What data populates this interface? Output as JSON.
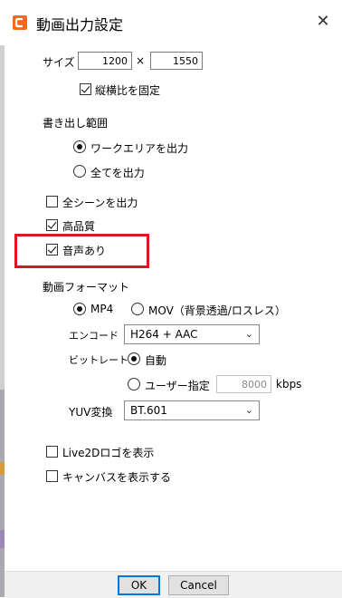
{
  "window": {
    "title": "動画出力設定",
    "close_glyph": "✕"
  },
  "size": {
    "label": "サイズ",
    "width": "1200",
    "separator": "×",
    "height": "1550",
    "keep_ratio_label": "縦横比を固定",
    "keep_ratio_checked": true
  },
  "export_range": {
    "heading": "書き出し範囲",
    "options": [
      {
        "label": "ワークエリアを出力",
        "selected": true
      },
      {
        "label": "全てを出力",
        "selected": false
      }
    ]
  },
  "checks": {
    "all_scenes": {
      "label": "全シーンを出力",
      "checked": false
    },
    "high_quality": {
      "label": "高品質",
      "checked": true
    },
    "audio": {
      "label": "音声あり",
      "checked": true
    }
  },
  "format": {
    "heading": "動画フォーマット",
    "mp4_label": "MP4",
    "mov_label": "MOV（背景透過/ロスレス）",
    "selected": "MP4",
    "encode_label": "エンコード",
    "encode_value": "H264 + AAC",
    "bitrate_label": "ビットレート",
    "bitrate_auto_label": "自動",
    "bitrate_user_label": "ユーザー指定",
    "bitrate_value": "8000",
    "bitrate_unit": "kbps",
    "yuv_label": "YUV変換",
    "yuv_value": "BT.601"
  },
  "bottom_checks": {
    "live2d_logo": {
      "label": "Live2Dロゴを表示",
      "checked": false
    },
    "canvas": {
      "label": "キャンバスを表示する",
      "checked": false
    }
  },
  "buttons": {
    "ok": "OK",
    "cancel": "Cancel"
  },
  "colors": {
    "highlight": "#e0141e",
    "app_icon": "#f26b1d",
    "default_button_border": "#0078d7"
  }
}
